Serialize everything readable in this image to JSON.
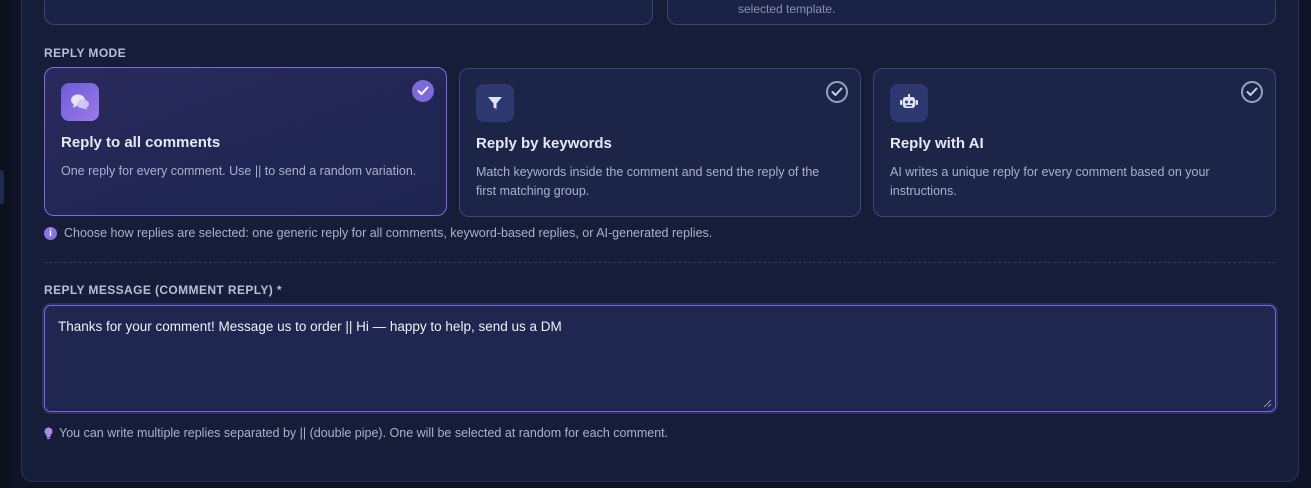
{
  "top": {
    "right_subtext": "selected template."
  },
  "reply_mode": {
    "label": "REPLY MODE",
    "options": [
      {
        "title": "Reply to all comments",
        "desc": "One reply for every comment. Use || to send a random variation.",
        "icon": "chat-bubbles-icon",
        "selected": true
      },
      {
        "title": "Reply by keywords",
        "desc": "Match keywords inside the comment and send the reply of the first matching group.",
        "icon": "filter-icon",
        "selected": false
      },
      {
        "title": "Reply with AI",
        "desc": "AI writes a unique reply for every comment based on your instructions.",
        "icon": "robot-icon",
        "selected": false
      }
    ],
    "hint": "Choose how replies are selected: one generic reply for all comments, keyword-based replies, or AI-generated replies."
  },
  "reply_message": {
    "label": "REPLY MESSAGE (COMMENT REPLY) *",
    "value": "Thanks for your comment! Message us to order || Hi — happy to help, send us a DM",
    "hint": "You can write multiple replies separated by || (double pipe). One will be selected at random for each comment."
  },
  "colors": {
    "accent": "#7b6ad9",
    "panel": "#161d38",
    "card": "#1c2448"
  }
}
